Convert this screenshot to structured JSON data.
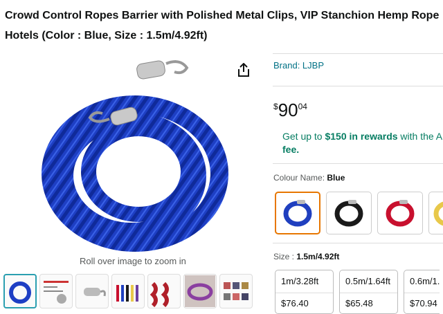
{
  "title": {
    "line1": "Crowd Control Ropes Barrier with Polished Metal Clips, VIP Stanchion Hemp Rope",
    "line2": "Hotels (Color : Blue, Size : 1.5m/4.92ft)"
  },
  "gallery": {
    "zoom_hint": "Roll over image to zoom in",
    "share_icon": "share-icon",
    "thumbnails": [
      {
        "name": "thumb-blue-rope"
      },
      {
        "name": "thumb-specification"
      },
      {
        "name": "thumb-polished-hooks"
      },
      {
        "name": "thumb-colors"
      },
      {
        "name": "thumb-hemp-rope"
      },
      {
        "name": "thumb-rope-lifestyle"
      },
      {
        "name": "thumb-occasions"
      }
    ]
  },
  "product": {
    "brand": "Brand: LJBP",
    "price": {
      "symbol": "$",
      "whole": "90",
      "fraction": "04"
    },
    "rewards": {
      "pre": "Get up to ",
      "amount": "$150 in rewards",
      "post": " with the A",
      "line2": "fee."
    },
    "colour": {
      "label": "Colour Name: ",
      "selected": "Blue",
      "options": [
        {
          "name": "Blue",
          "hex": "#1f3fbf"
        },
        {
          "name": "Black",
          "hex": "#1a1a1a"
        },
        {
          "name": "Red",
          "hex": "#c8102e"
        },
        {
          "name": "Gold",
          "hex": "#e8c84a"
        }
      ]
    },
    "size": {
      "label": "Size : ",
      "selected": "1.5m/4.92ft",
      "options": [
        {
          "label": "1m/3.28ft",
          "price": "$76.40"
        },
        {
          "label": "0.5m/1.64ft",
          "price": "$65.48"
        },
        {
          "label": "0.6m/1.",
          "price": "$70.94"
        }
      ]
    }
  },
  "colors": {
    "link": "#007185",
    "reward": "#067d62",
    "selected_border": "#e77600",
    "thumb_selected": "#2a9fb0"
  }
}
